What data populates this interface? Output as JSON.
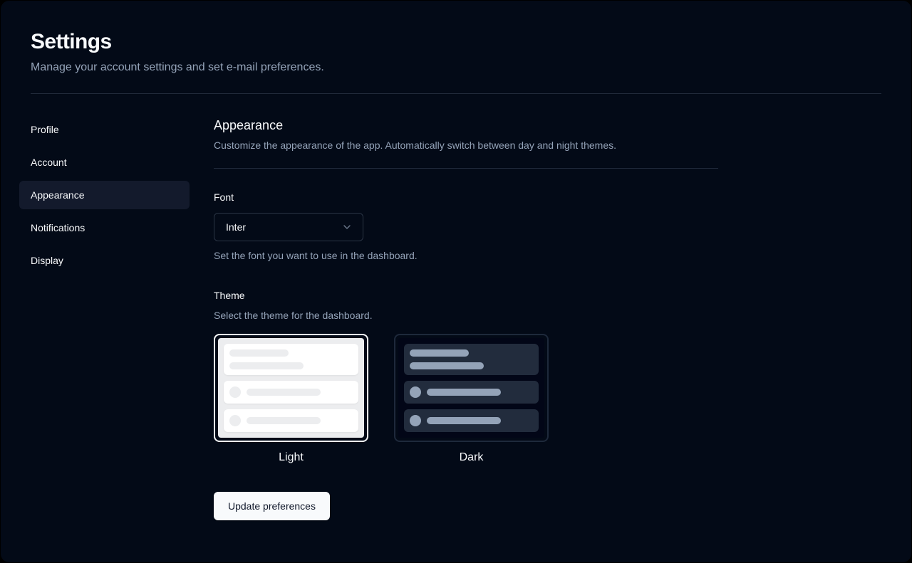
{
  "page": {
    "title": "Settings",
    "subtitle": "Manage your account settings and set e-mail preferences."
  },
  "sidebar": {
    "items": [
      {
        "label": "Profile",
        "active": false
      },
      {
        "label": "Account",
        "active": false
      },
      {
        "label": "Appearance",
        "active": true
      },
      {
        "label": "Notifications",
        "active": false
      },
      {
        "label": "Display",
        "active": false
      }
    ]
  },
  "main": {
    "heading": "Appearance",
    "description": "Customize the appearance of the app. Automatically switch between day and night themes.",
    "font_field": {
      "label": "Font",
      "value": "Inter",
      "help": "Set the font you want to use in the dashboard."
    },
    "theme_field": {
      "label": "Theme",
      "help": "Select the theme for the dashboard.",
      "options": [
        {
          "label": "Light",
          "selected": true
        },
        {
          "label": "Dark",
          "selected": false
        }
      ]
    },
    "submit_label": "Update preferences"
  },
  "colors": {
    "page_background": "#030a17",
    "outer_background": "#000000",
    "foreground": "#f8fafc",
    "muted_foreground": "#94a3b8",
    "border": "#212a3b",
    "input_border": "#2a3444",
    "active_nav_background": "#131a2c",
    "selected_ring": "#f8fafc",
    "unselected_ring": "#1e293b",
    "light_preview_panel": "#ecedef",
    "light_preview_card": "#ffffff",
    "dark_preview_panel": "#020617",
    "dark_preview_card": "#222c3d",
    "dark_preview_skeleton": "#94a3b8",
    "button_background": "#f8fafc",
    "button_text": "#0f172a"
  }
}
